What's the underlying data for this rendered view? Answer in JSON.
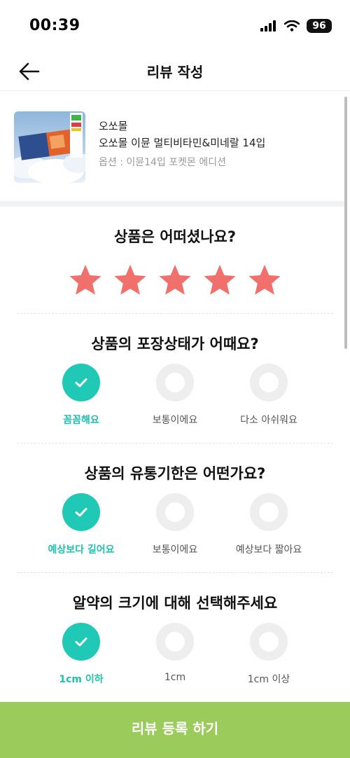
{
  "status_bar": {
    "time": "00:39",
    "battery": "96"
  },
  "nav": {
    "title": "리뷰 작성"
  },
  "product": {
    "brand": "오쏘몰",
    "name": "오쏘몰 이뮨 멀티비타민&미네랄 14입",
    "option": "옵션 : 이뮨14입 포켓몬 에디션"
  },
  "rating": {
    "question": "상품은 어떠셨나요?",
    "value": 5,
    "max": 5
  },
  "packaging": {
    "question": "상품의 포장상태가 어때요?",
    "options": [
      "꼼꼼해요",
      "보통이에요",
      "다소 아쉬워요"
    ],
    "selected_index": 0
  },
  "expiry": {
    "question": "상품의 유통기한은 어떤가요?",
    "options": [
      "예상보다 길어요",
      "보통이에요",
      "예상보다 짧아요"
    ],
    "selected_index": 0
  },
  "pill_size": {
    "question": "알약의 크기에 대해 선택해주세요",
    "options": [
      "1cm 이하",
      "1cm",
      "1cm 이상"
    ],
    "selected_index": 0
  },
  "submit": {
    "label": "리뷰 등록 하기"
  },
  "colors": {
    "accent": "#1fc9b5",
    "star": "#f2706c",
    "submit_bg": "#9acb5b"
  },
  "icons": [
    "back-arrow-icon",
    "signal-icon",
    "wifi-icon",
    "battery-icon",
    "star-icon",
    "check-icon"
  ]
}
